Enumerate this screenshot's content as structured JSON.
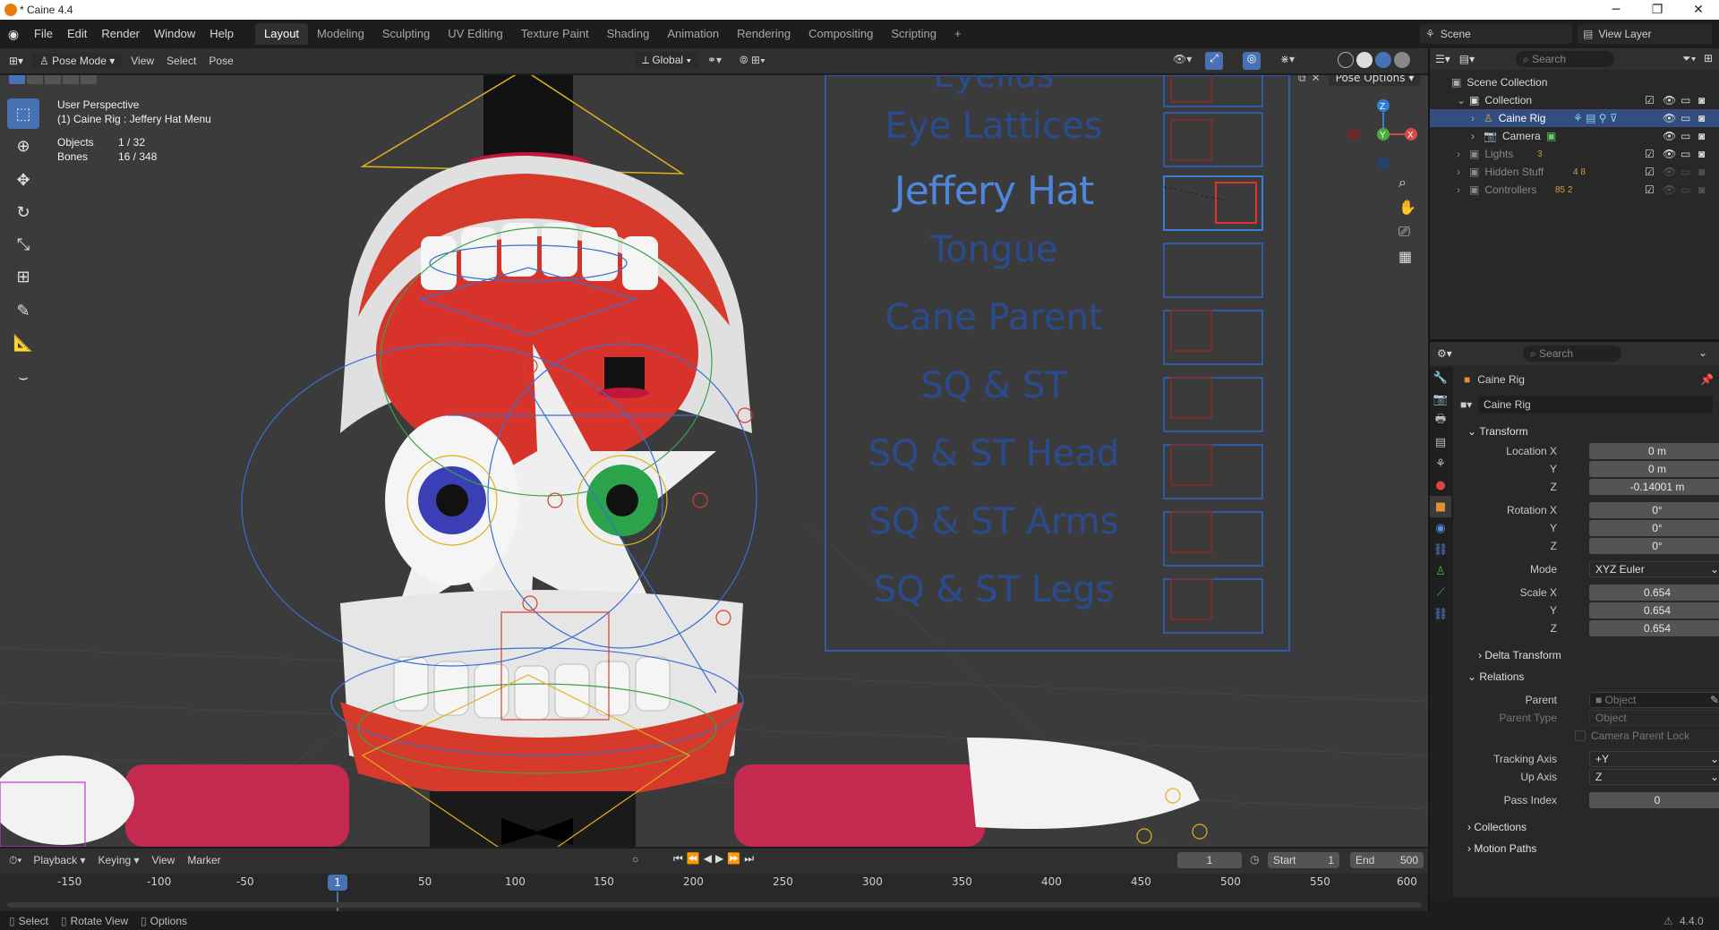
{
  "titlebar": {
    "title": "* Caine 4.4",
    "minimize": "─",
    "maximize": "❐",
    "close": "✕"
  },
  "menubar": {
    "menus": [
      "File",
      "Edit",
      "Render",
      "Window",
      "Help"
    ],
    "workspaces": [
      "Layout",
      "Modeling",
      "Sculpting",
      "UV Editing",
      "Texture Paint",
      "Shading",
      "Animation",
      "Rendering",
      "Compositing",
      "Scripting"
    ],
    "add_workspace": "+",
    "scene": "Scene",
    "view_layer": "View Layer"
  },
  "viewport_header": {
    "mode": "Pose Mode",
    "menus": [
      "View",
      "Select",
      "Pose"
    ],
    "orientation": "Global",
    "pose_options": "Pose Options"
  },
  "viewport_overlay": {
    "perspective": "User Perspective",
    "active": "(1) Caine Rig : Jeffery Hat Menu",
    "objects_label": "Objects",
    "objects_value": "1 / 32",
    "bones_label": "Bones",
    "bones_value": "16 / 348",
    "gizmo_axes": [
      "X",
      "Y",
      "Z"
    ]
  },
  "rig_menu": {
    "items": [
      "Eyelids",
      "Eye Lattices",
      "Jeffery Hat",
      "Tongue",
      "Cane Parent",
      "SQ & ST",
      "SQ & ST Head",
      "SQ & ST Arms",
      "SQ & ST Legs"
    ],
    "highlighted": "Jeffery Hat"
  },
  "outliner": {
    "search_placeholder": "Search",
    "root": "Scene Collection",
    "rows": [
      {
        "label": "Collection",
        "level": 1
      },
      {
        "label": "Caine Rig",
        "level": 2,
        "selected": true
      },
      {
        "label": "Camera",
        "level": 2
      },
      {
        "label": "Lights",
        "level": 1,
        "badge": "3"
      },
      {
        "label": "Hidden Stuff",
        "level": 1,
        "badge": "4 8"
      },
      {
        "label": "Controllers",
        "level": 1,
        "badge": "85 2"
      }
    ]
  },
  "properties": {
    "search_placeholder": "Search",
    "object_name": "Caine Rig",
    "object_field": "Caine Rig",
    "transform": {
      "title": "Transform",
      "location_label": "Location X",
      "location": [
        "0 m",
        "0 m",
        "-0.14001 m"
      ],
      "rotation_label": "Rotation X",
      "rotation": [
        "0°",
        "0°",
        "0°"
      ],
      "mode_label": "Mode",
      "mode": "XYZ Euler",
      "scale_label": "Scale X",
      "scale": [
        "0.654",
        "0.654",
        "0.654"
      ],
      "y_label": "Y",
      "z_label": "Z"
    },
    "delta_transform": "Delta Transform",
    "relations": {
      "title": "Relations",
      "parent_label": "Parent",
      "parent_placeholder": "Object",
      "parent_type_label": "Parent Type",
      "parent_type": "Object",
      "camera_parent_lock": "Camera Parent Lock",
      "tracking_axis_label": "Tracking Axis",
      "tracking_axis": "+Y",
      "up_axis_label": "Up Axis",
      "up_axis": "Z",
      "pass_index_label": "Pass Index",
      "pass_index": "0"
    },
    "collections": "Collections",
    "motion_paths": "Motion Paths"
  },
  "timeline": {
    "menus": [
      "Playback",
      "Keying",
      "View",
      "Marker"
    ],
    "current_frame": "1",
    "start_label": "Start",
    "start": "1",
    "end_label": "End",
    "end": "500",
    "ticks": [
      "-150",
      "-100",
      "-50",
      "1",
      "50",
      "100",
      "150",
      "200",
      "250",
      "300",
      "350",
      "400",
      "450",
      "500",
      "550",
      "600"
    ]
  },
  "statusbar": {
    "select": "Select",
    "rotate": "Rotate View",
    "options": "Options",
    "version": "4.4.0"
  },
  "colors": {
    "accent": "#4772b3",
    "selected_row": "#334d80",
    "bone_blue": "#3b6fd1",
    "mouth_red": "#d83c2c",
    "arm_magenta": "#c42a4f"
  }
}
